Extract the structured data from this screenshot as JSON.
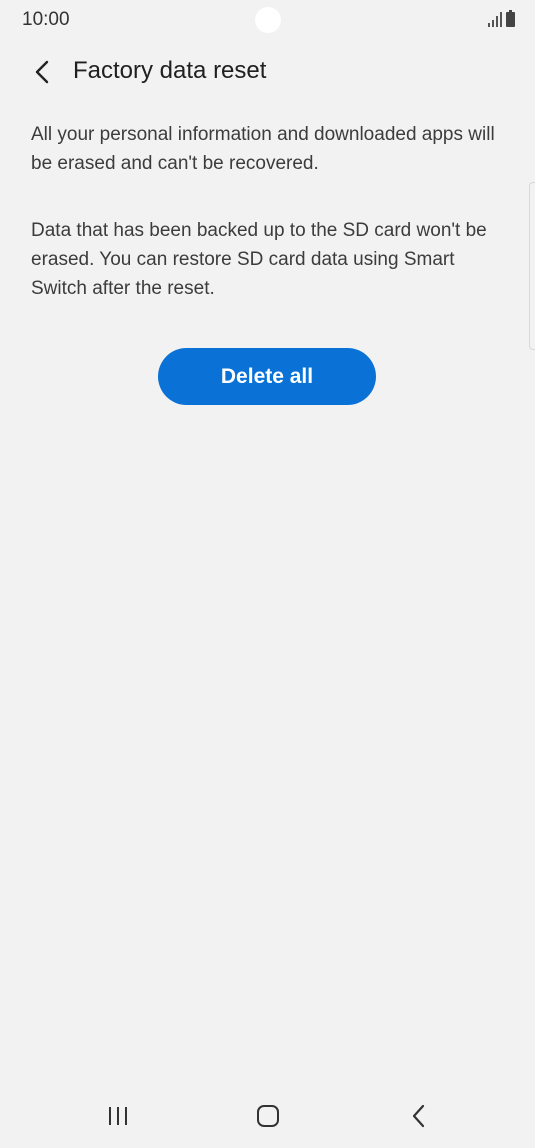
{
  "status_bar": {
    "time": "10:00",
    "icons": [
      "camera-cutout",
      "signal-icon",
      "battery-icon"
    ]
  },
  "app_bar": {
    "back_icon": "chevron-left-icon",
    "title": "Factory data reset"
  },
  "content": {
    "paragraph_1": "All your personal information and downloaded apps will be erased and can't be recovered.",
    "paragraph_2": "Data that has been backed up to the SD card won't be erased. You can restore SD card data using Smart Switch after the reset."
  },
  "actions": {
    "delete_all_label": "Delete all",
    "accent_color": "#0a72d6"
  },
  "nav_bar": {
    "icons": [
      "recents-icon",
      "home-icon",
      "back-icon"
    ]
  }
}
